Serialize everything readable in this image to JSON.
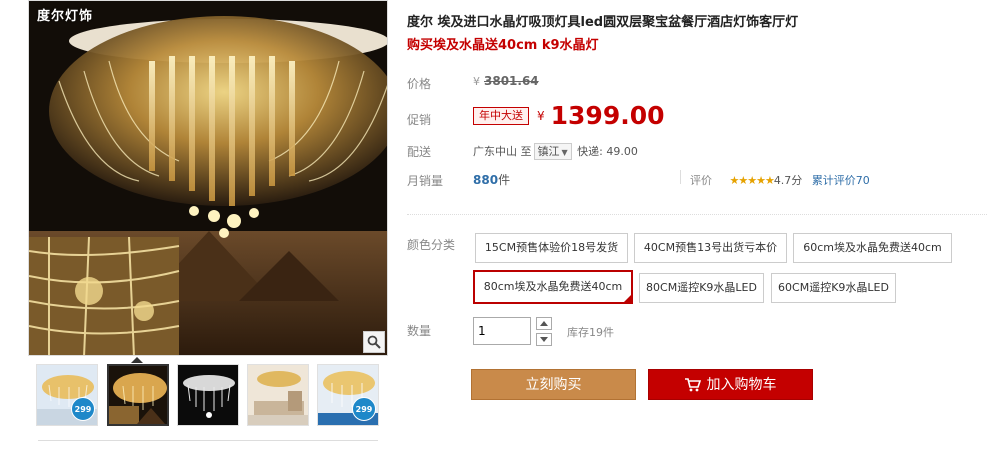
{
  "gallery": {
    "brand_logo": "度尔灯饰",
    "thumbs": [
      {
        "icon": "thumbnail-image",
        "badge": "299"
      },
      {
        "icon": "thumbnail-image",
        "badge": ""
      },
      {
        "icon": "thumbnail-image",
        "badge": ""
      },
      {
        "icon": "thumbnail-image",
        "badge": ""
      },
      {
        "icon": "thumbnail-image",
        "badge": "299"
      }
    ],
    "active_thumb": 1
  },
  "product": {
    "title": "度尔 埃及进口水晶灯吸顶灯具led圆双层聚宝盆餐厅酒店灯饰客厅灯",
    "subtitle": "购买埃及水晶送40cm k9水晶灯"
  },
  "price": {
    "label": "价格",
    "currency": "¥",
    "original": "3801.64"
  },
  "promo": {
    "label": "促销",
    "tag": "年中大送",
    "currency": "¥",
    "price": "1399.00"
  },
  "shipping": {
    "label": "配送",
    "from": "广东中山",
    "to_word": "至",
    "destination": "镇江",
    "express": "快递: 49.00"
  },
  "sales": {
    "label": "月销量",
    "count": "880",
    "unit": "件"
  },
  "review": {
    "label": "评价",
    "stars": "★★★★★",
    "score": "4.7分",
    "cumulative": "累计评价70"
  },
  "options": {
    "label": "颜色分类",
    "items": [
      "15CM预售体验价18号发货",
      "40CM预售13号出货亏本价",
      "60cm埃及水晶免费送40cm",
      "80cm埃及水晶免费送40cm",
      "80CM遥控K9水晶LED",
      "60CM遥控K9水晶LED"
    ],
    "selected_index": 3
  },
  "quantity": {
    "label": "数量",
    "value": "1",
    "stock": "库存19件"
  },
  "buttons": {
    "buy_now": "立刻购买",
    "add_cart": "加入购物车"
  },
  "colors": {
    "accent_red": "#c40000",
    "buy_button": "#c98a4a",
    "link_blue": "#2f6ea8"
  }
}
